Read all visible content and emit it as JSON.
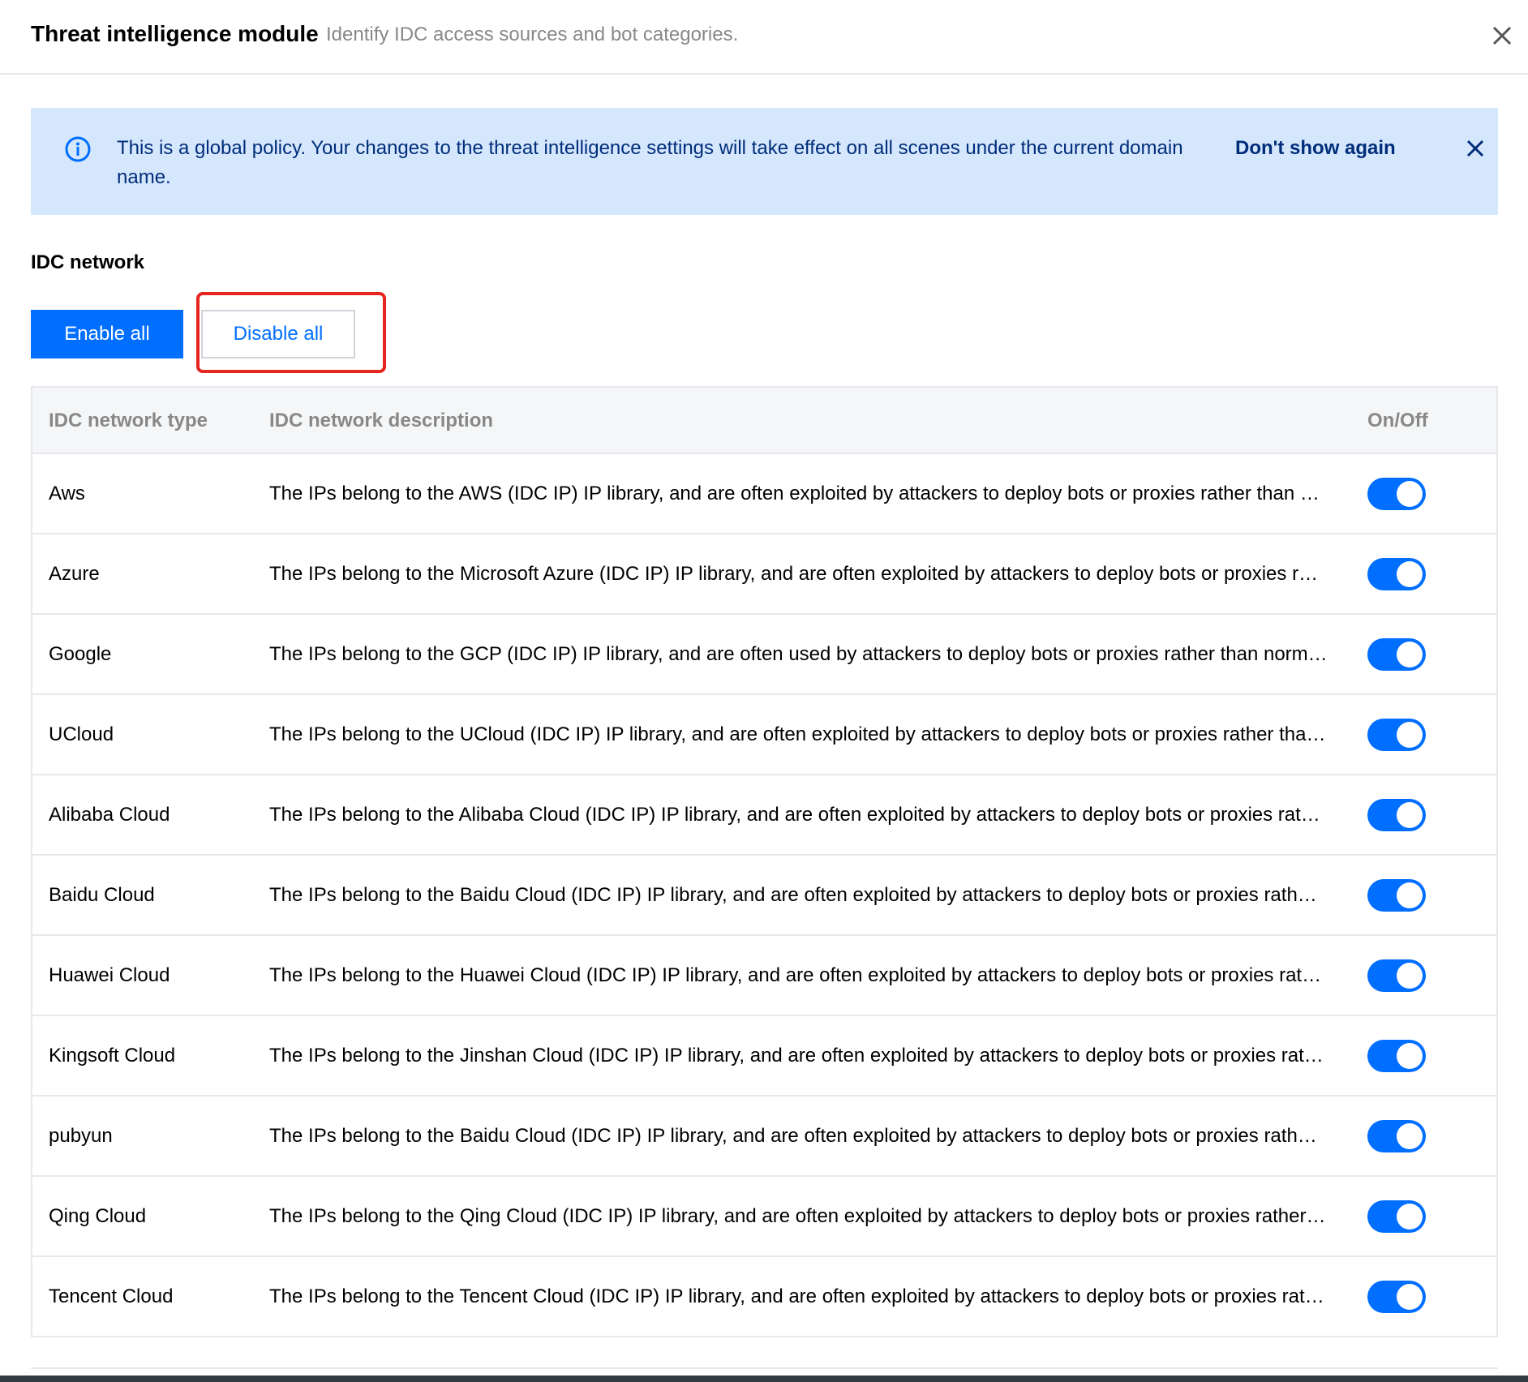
{
  "header": {
    "title": "Threat intelligence module",
    "subtitle": "Identify IDC access sources and bot categories."
  },
  "notice": {
    "text": "This is a global policy. Your changes to the threat intelligence settings will take effect on all scenes under the current domain name.",
    "link_label": "Don't show again"
  },
  "section": {
    "title": "IDC network"
  },
  "buttons": {
    "enable_all": "Enable all",
    "disable_all": "Disable all"
  },
  "table": {
    "columns": {
      "type": "IDC network type",
      "description": "IDC network description",
      "onoff": "On/Off"
    },
    "rows": [
      {
        "type": "Aws",
        "description": "The IPs belong to the AWS (IDC IP) IP library, and are often exploited by attackers to deploy bots or proxies rather than …",
        "enabled": true
      },
      {
        "type": "Azure",
        "description": "The IPs belong to the Microsoft Azure (IDC IP) IP library, and are often exploited by attackers to deploy bots or proxies r…",
        "enabled": true
      },
      {
        "type": "Google",
        "description": "The IPs belong to the GCP (IDC IP) IP library, and are often used by attackers to deploy bots or proxies rather than norm…",
        "enabled": true
      },
      {
        "type": "UCloud",
        "description": "The IPs belong to the UCloud (IDC IP) IP library, and are often exploited by attackers to deploy bots or proxies rather tha…",
        "enabled": true
      },
      {
        "type": "Alibaba Cloud",
        "description": "The IPs belong to the Alibaba Cloud (IDC IP) IP library, and are often exploited by attackers to deploy bots or proxies rat…",
        "enabled": true
      },
      {
        "type": "Baidu Cloud",
        "description": "The IPs belong to the Baidu Cloud (IDC IP) IP library, and are often exploited by attackers to deploy bots or proxies rath…",
        "enabled": true
      },
      {
        "type": "Huawei Cloud",
        "description": "The IPs belong to the Huawei Cloud (IDC IP) IP library, and are often exploited by attackers to deploy bots or proxies rat…",
        "enabled": true
      },
      {
        "type": "Kingsoft Cloud",
        "description": "The IPs belong to the Jinshan Cloud (IDC IP) IP library, and are often exploited by attackers to deploy bots or proxies rat…",
        "enabled": true
      },
      {
        "type": "pubyun",
        "description": "The IPs belong to the Baidu Cloud (IDC IP) IP library, and are often exploited by attackers to deploy bots or proxies rath…",
        "enabled": true
      },
      {
        "type": "Qing Cloud",
        "description": "The IPs belong to the Qing Cloud (IDC IP) IP library, and are often exploited by attackers to deploy bots or proxies rather…",
        "enabled": true
      },
      {
        "type": "Tencent Cloud",
        "description": "The IPs belong to the Tencent Cloud (IDC IP) IP library, and are often exploited by attackers to deploy bots or proxies rat…",
        "enabled": true
      }
    ]
  },
  "icons": {
    "close": "close-icon",
    "info": "info-icon",
    "notice_close": "close-icon"
  },
  "colors": {
    "primary": "#006eff",
    "notice_bg": "#d5e7fd",
    "notice_text": "#002d7a",
    "highlight": "#e5261f"
  }
}
